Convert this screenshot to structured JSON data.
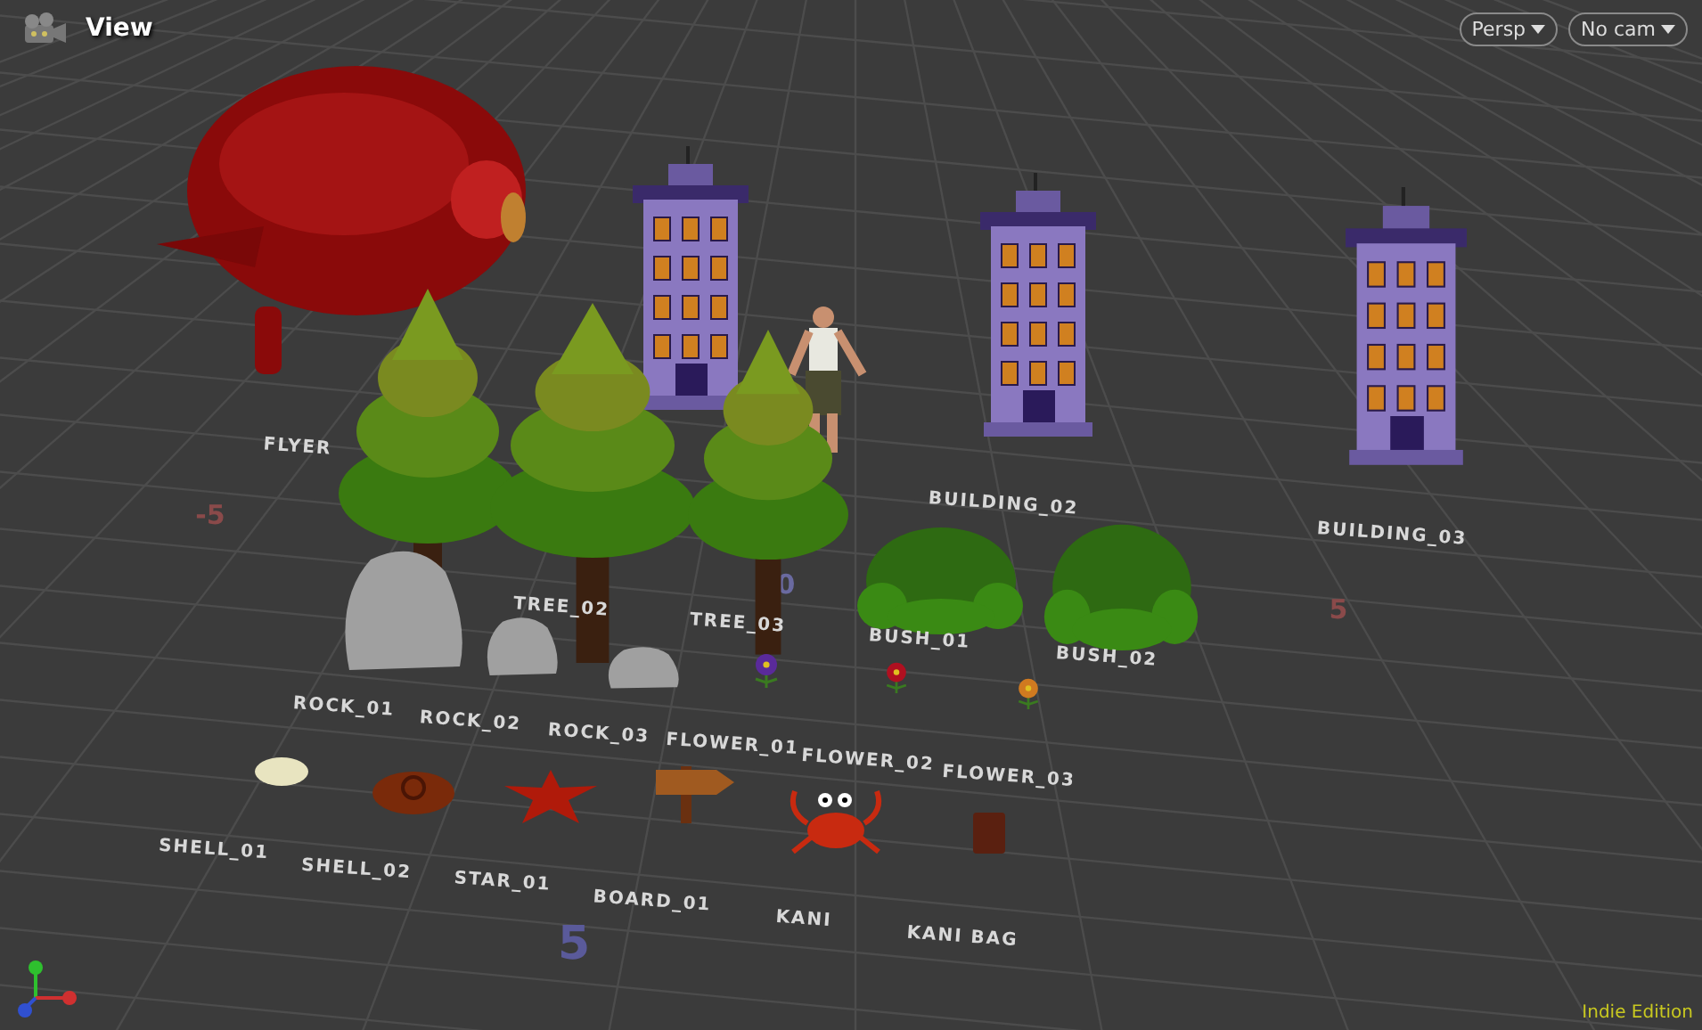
{
  "viewport": {
    "title": "View",
    "camera_menus": [
      {
        "label": "Persp"
      },
      {
        "label": "No cam"
      }
    ],
    "objects": [
      {
        "kind": "flyer",
        "label": "FLYER"
      },
      {
        "kind": "building"
      },
      {
        "kind": "building",
        "label": "BUILDING_02"
      },
      {
        "kind": "building",
        "label": "BUILDING_03"
      },
      {
        "kind": "figure"
      },
      {
        "kind": "tree"
      },
      {
        "kind": "tree",
        "label": "TREE_02"
      },
      {
        "kind": "tree",
        "label": "TREE_03"
      },
      {
        "kind": "bush",
        "label": "BUSH_01"
      },
      {
        "kind": "bush",
        "label": "BUSH_02"
      },
      {
        "kind": "rock",
        "label": "ROCK_01"
      },
      {
        "kind": "rock",
        "label": "ROCK_02"
      },
      {
        "kind": "rock",
        "label": "ROCK_03"
      },
      {
        "kind": "flower",
        "label": "FLOWER_01",
        "color": "#5a2a9a"
      },
      {
        "kind": "flower",
        "label": "FLOWER_02",
        "color": "#b01020"
      },
      {
        "kind": "flower",
        "label": "FLOWER_03",
        "color": "#d07a20"
      },
      {
        "kind": "shell",
        "label": "SHELL_01"
      },
      {
        "kind": "snail_shell",
        "label": "SHELL_02"
      },
      {
        "kind": "star",
        "label": "STAR_01"
      },
      {
        "kind": "board",
        "label": "BOARD_01"
      },
      {
        "kind": "crab",
        "label": "KANI"
      },
      {
        "kind": "bag",
        "label": "KANI BAG"
      }
    ],
    "axis_numbers": [
      {
        "text": "-5",
        "color": "#8a4a4a"
      },
      {
        "text": "0",
        "color": "#6a6aa0"
      },
      {
        "text": "5",
        "color": "#8a4a4a"
      },
      {
        "text": "5",
        "color": "#5a5a9a"
      }
    ],
    "edition": "Indie Edition"
  }
}
